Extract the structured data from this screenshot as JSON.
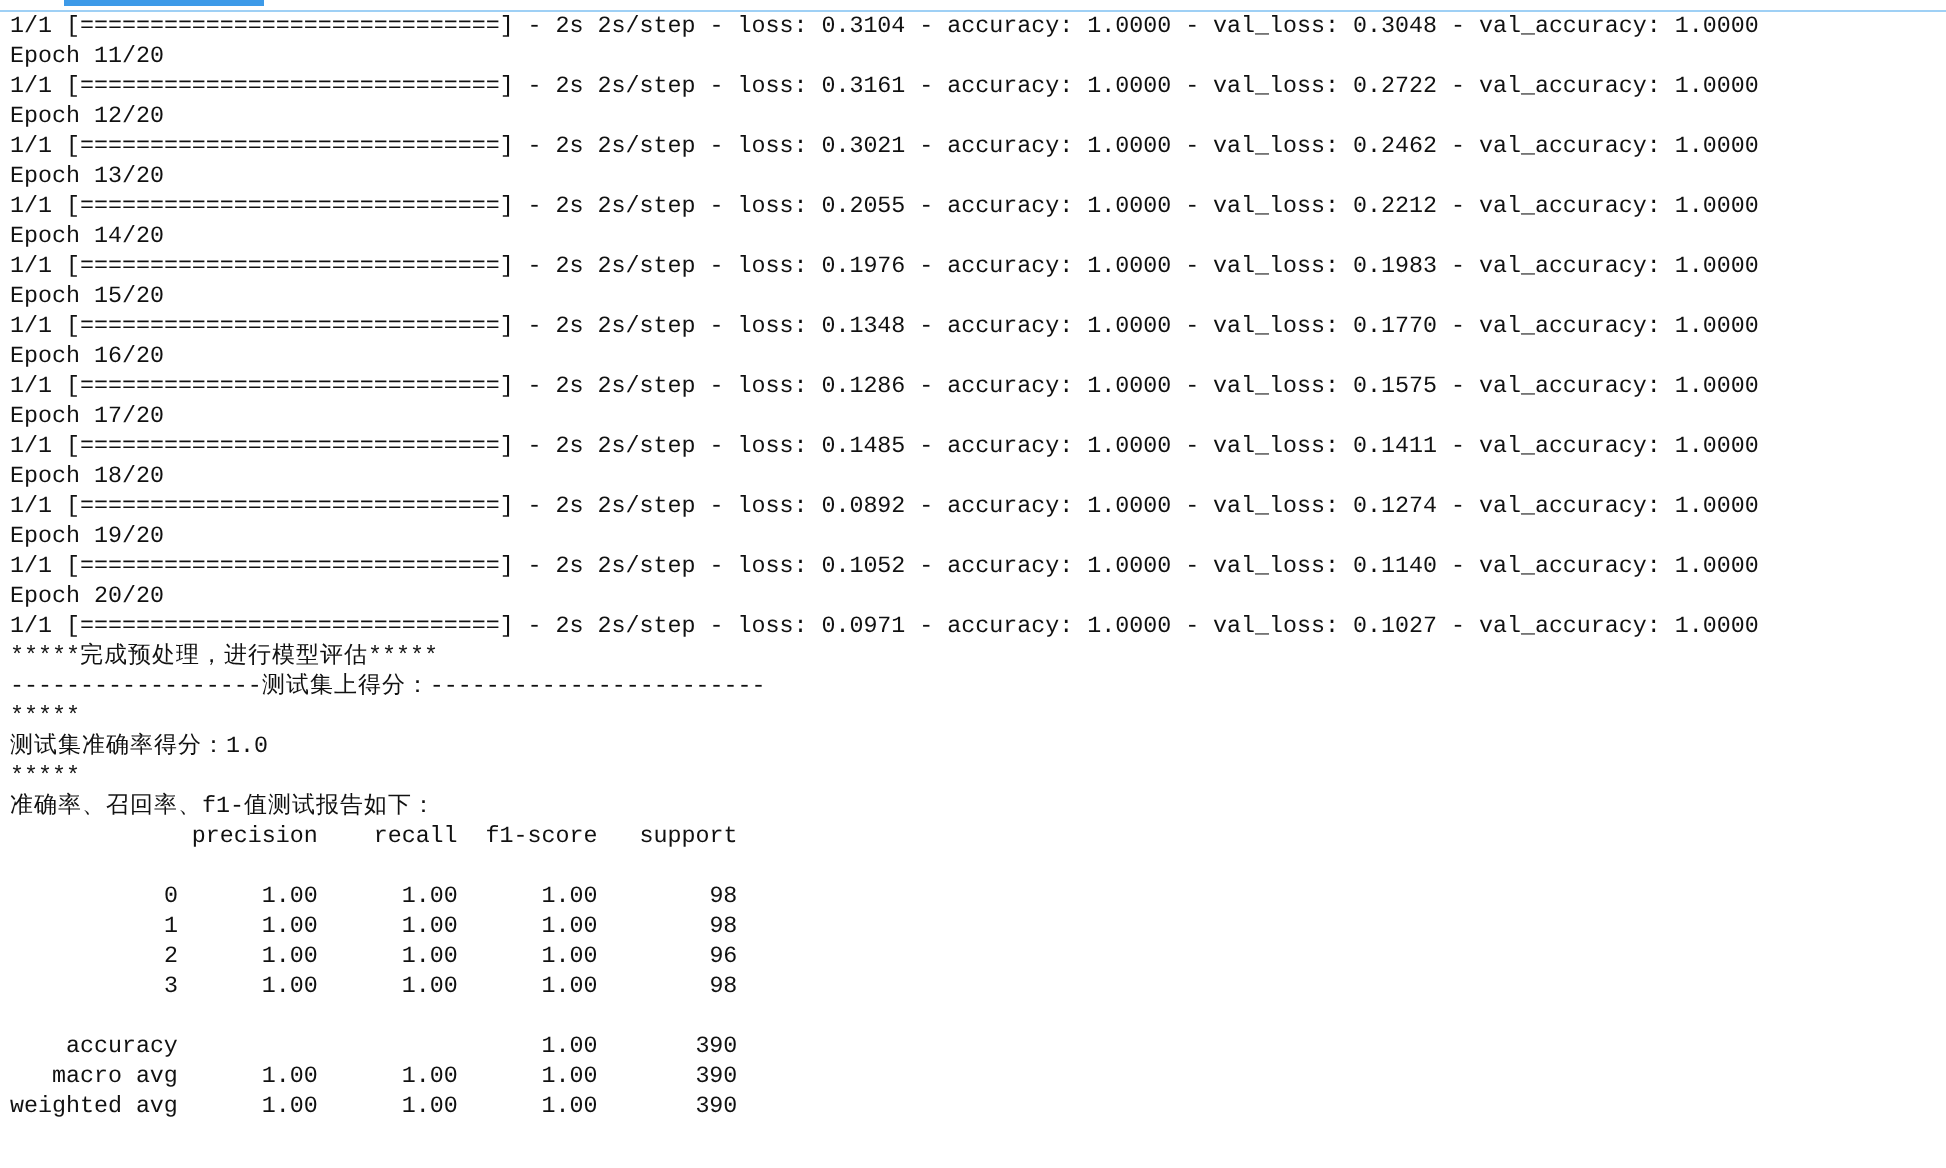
{
  "log": [
    "1/1 [==============================] - 2s 2s/step - loss: 0.3104 - accuracy: 1.0000 - val_loss: 0.3048 - val_accuracy: 1.0000",
    "Epoch 11/20",
    "1/1 [==============================] - 2s 2s/step - loss: 0.3161 - accuracy: 1.0000 - val_loss: 0.2722 - val_accuracy: 1.0000",
    "Epoch 12/20",
    "1/1 [==============================] - 2s 2s/step - loss: 0.3021 - accuracy: 1.0000 - val_loss: 0.2462 - val_accuracy: 1.0000",
    "Epoch 13/20",
    "1/1 [==============================] - 2s 2s/step - loss: 0.2055 - accuracy: 1.0000 - val_loss: 0.2212 - val_accuracy: 1.0000",
    "Epoch 14/20",
    "1/1 [==============================] - 2s 2s/step - loss: 0.1976 - accuracy: 1.0000 - val_loss: 0.1983 - val_accuracy: 1.0000",
    "Epoch 15/20",
    "1/1 [==============================] - 2s 2s/step - loss: 0.1348 - accuracy: 1.0000 - val_loss: 0.1770 - val_accuracy: 1.0000",
    "Epoch 16/20",
    "1/1 [==============================] - 2s 2s/step - loss: 0.1286 - accuracy: 1.0000 - val_loss: 0.1575 - val_accuracy: 1.0000",
    "Epoch 17/20",
    "1/1 [==============================] - 2s 2s/step - loss: 0.1485 - accuracy: 1.0000 - val_loss: 0.1411 - val_accuracy: 1.0000",
    "Epoch 18/20",
    "1/1 [==============================] - 2s 2s/step - loss: 0.0892 - accuracy: 1.0000 - val_loss: 0.1274 - val_accuracy: 1.0000",
    "Epoch 19/20",
    "1/1 [==============================] - 2s 2s/step - loss: 0.1052 - accuracy: 1.0000 - val_loss: 0.1140 - val_accuracy: 1.0000",
    "Epoch 20/20",
    "1/1 [==============================] - 2s 2s/step - loss: 0.0971 - accuracy: 1.0000 - val_loss: 0.1027 - val_accuracy: 1.0000",
    "*****完成预处理，进行模型评估*****",
    "------------------测试集上得分：------------------------",
    "*****",
    "测试集准确率得分：1.0",
    "*****",
    "准确率、召回率、f1-值测试报告如下："
  ],
  "report": {
    "columns": [
      "precision",
      "recall",
      "f1-score",
      "support"
    ],
    "class_rows": [
      {
        "label": "0",
        "precision": "1.00",
        "recall": "1.00",
        "f1_score": "1.00",
        "support": "98"
      },
      {
        "label": "1",
        "precision": "1.00",
        "recall": "1.00",
        "f1_score": "1.00",
        "support": "98"
      },
      {
        "label": "2",
        "precision": "1.00",
        "recall": "1.00",
        "f1_score": "1.00",
        "support": "96"
      },
      {
        "label": "3",
        "precision": "1.00",
        "recall": "1.00",
        "f1_score": "1.00",
        "support": "98"
      }
    ],
    "summary_rows": [
      {
        "label": "accuracy",
        "f1_score": "1.00",
        "support": "390"
      },
      {
        "label": "macro avg",
        "precision": "1.00",
        "recall": "1.00",
        "f1_score": "1.00",
        "support": "390"
      },
      {
        "label": "weighted avg",
        "precision": "1.00",
        "recall": "1.00",
        "f1_score": "1.00",
        "support": "390"
      }
    ]
  }
}
